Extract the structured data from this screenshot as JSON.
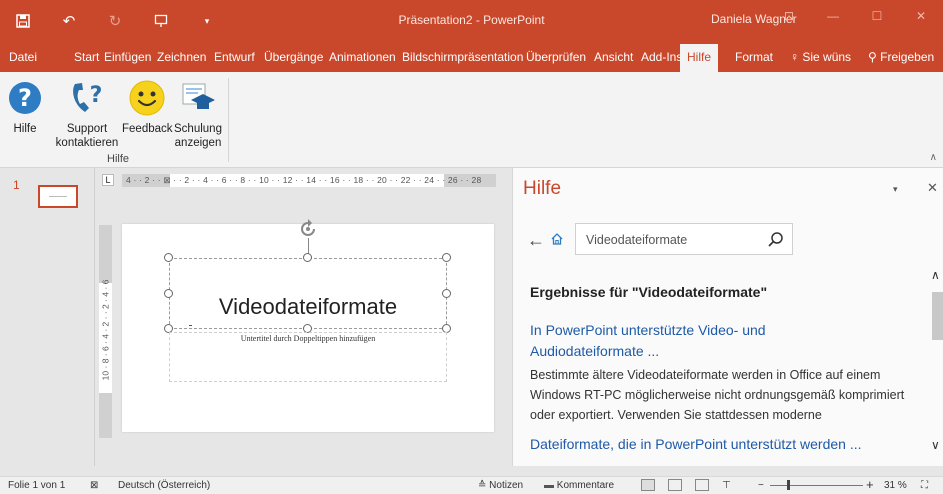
{
  "titlebar": {
    "title": "Präsentation2  -  PowerPoint",
    "user": "Daniela Wagner",
    "qat": {
      "save_icon": "save-icon",
      "undo_icon": "undo-icon",
      "redo_icon": "redo-icon",
      "start_icon": "slideshow-start-icon",
      "customize_icon": "chevron-down-icon"
    }
  },
  "tabs": [
    {
      "label": "Datei"
    },
    {
      "label": "Start"
    },
    {
      "label": "Einfügen"
    },
    {
      "label": "Zeichnen"
    },
    {
      "label": "Entwurf"
    },
    {
      "label": "Übergänge"
    },
    {
      "label": "Animationen"
    },
    {
      "label": "Bildschirmpräsentation"
    },
    {
      "label": "Überprüfen"
    },
    {
      "label": "Ansicht"
    },
    {
      "label": "Add-Ins"
    },
    {
      "label": "Hilfe"
    },
    {
      "label": "Format"
    }
  ],
  "tell_me": "Sie wüns",
  "share": "Freigeben",
  "ribbon": {
    "buttons": [
      {
        "line1": "Hilfe",
        "line2": ""
      },
      {
        "line1": "Support",
        "line2": "kontaktieren"
      },
      {
        "line1": "Feedback",
        "line2": ""
      },
      {
        "line1": "Schulung",
        "line2": "anzeigen"
      }
    ],
    "group_label": "Hilfe"
  },
  "slides_pane": {
    "slide_number": "1"
  },
  "ruler": {
    "horizontal": "4 · · 2 · · ⊠ · · 2 · · 4 · · 6 · · 8 · · 10 · · 12 · · 14 · · 16 · · 18 · · 20 · · 22 · · 24 · · 26 · · 28",
    "vertical": "10 · 8 · 6 · 4 · 2 · · 2 · 4 · 6",
    "corner": "L"
  },
  "slide": {
    "title": "Videodateiformate",
    "subtitle": "Untertitel durch Doppeltippen hinzufügen"
  },
  "help": {
    "title": "Hilfe",
    "search_value": "Videodateiformate",
    "results_heading": "Ergebnisse für \"Videodateiformate\"",
    "results": [
      {
        "title_line1": "In PowerPoint unterstützte Video- und",
        "title_line2": "Audiodateiformate ...",
        "description": "Bestimmte ältere Videodateiformate werden in Office auf einem Windows RT-PC möglicherweise nicht ordnungsgemäß komprimiert oder exportiert. Verwenden Sie stattdessen moderne"
      },
      {
        "title_line1": "Dateiformate, die in PowerPoint unterstützt werden ...",
        "title_line2": "",
        "description": ""
      }
    ]
  },
  "statusbar": {
    "slide_info": "Folie 1 von 1",
    "language": "Deutsch (Österreich)",
    "notes": "Notizen",
    "comments": "Kommentare",
    "zoom": "31 %"
  },
  "colors": {
    "accent": "#c9472a",
    "link": "#1e5aa8"
  }
}
